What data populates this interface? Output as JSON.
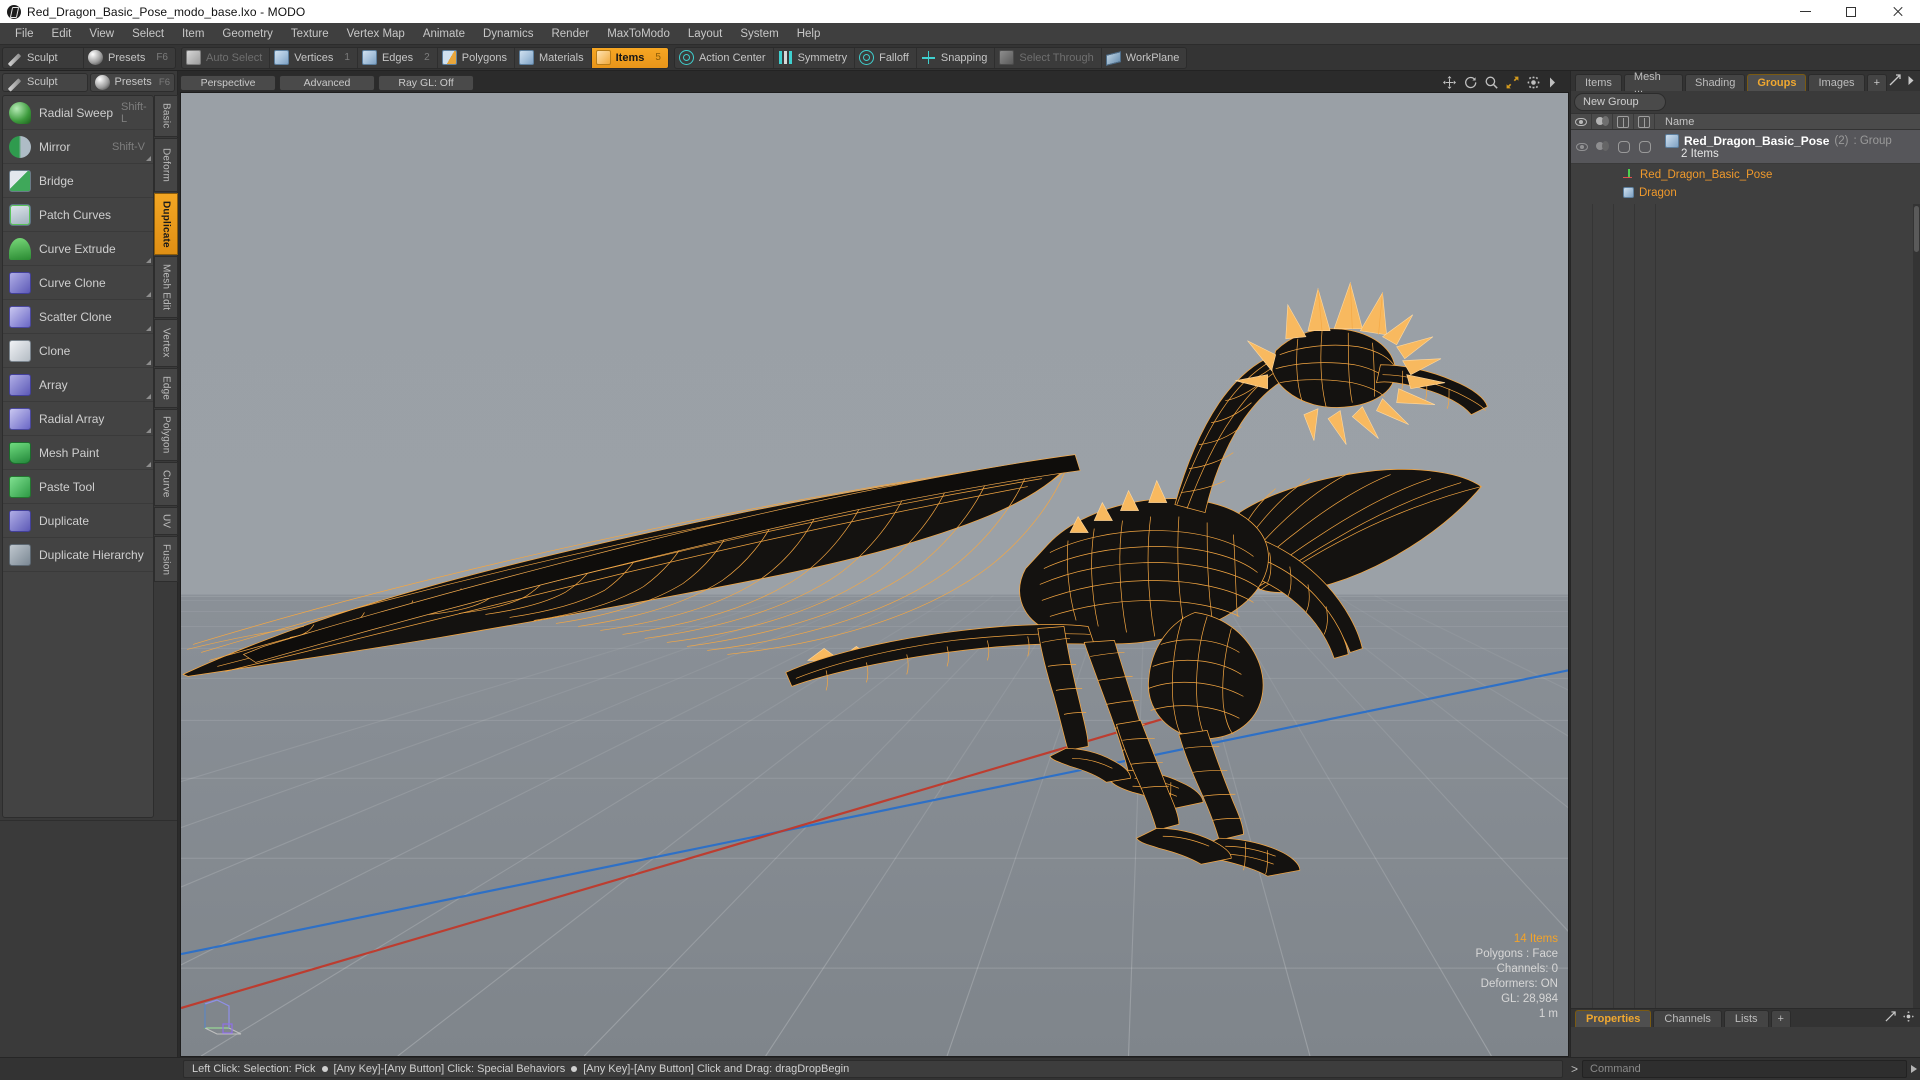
{
  "window": {
    "title": "Red_Dragon_Basic_Pose_modo_base.lxo - MODO",
    "minimize": "minimize",
    "maximize": "maximize",
    "close": "close"
  },
  "menubar": {
    "items": [
      {
        "label": "File"
      },
      {
        "label": "Edit"
      },
      {
        "label": "View"
      },
      {
        "label": "Select"
      },
      {
        "label": "Item"
      },
      {
        "label": "Geometry"
      },
      {
        "label": "Texture"
      },
      {
        "label": "Vertex Map"
      },
      {
        "label": "Animate"
      },
      {
        "label": "Dynamics"
      },
      {
        "label": "Render"
      },
      {
        "label": "MaxToModo"
      },
      {
        "label": "Layout"
      },
      {
        "label": "System"
      },
      {
        "label": "Help"
      }
    ]
  },
  "toolbar": {
    "left_group": [
      {
        "label": "Sculpt",
        "key": "",
        "icon": "pencil-icon",
        "state": "normal"
      },
      {
        "label": "Presets",
        "key": "F6",
        "icon": "sphere-icon",
        "state": "normal"
      }
    ],
    "selection_group": [
      {
        "label": "Auto Select",
        "num": "",
        "icon": "cube-grey-icon",
        "state": "dim"
      },
      {
        "label": "Vertices",
        "num": "1",
        "icon": "cube-icon",
        "state": "normal"
      },
      {
        "label": "Edges",
        "num": "2",
        "icon": "cube-icon",
        "state": "normal"
      },
      {
        "label": "Polygons",
        "num": "",
        "icon": "cube-half-icon",
        "state": "normal"
      },
      {
        "label": "Materials",
        "num": "",
        "icon": "cube-icon",
        "state": "normal"
      },
      {
        "label": "Items",
        "num": "5",
        "icon": "cube-orange-icon",
        "state": "active"
      }
    ],
    "modifier_group": [
      {
        "label": "Action Center",
        "icon": "crosshair-icon",
        "state": "normal"
      },
      {
        "label": "Symmetry",
        "icon": "bars-icon",
        "state": "normal"
      },
      {
        "label": "Falloff",
        "icon": "target-icon",
        "state": "normal"
      },
      {
        "label": "Snapping",
        "icon": "snap-icon",
        "state": "normal"
      },
      {
        "label": "Select Through",
        "icon": "select-through-icon",
        "state": "dim"
      },
      {
        "label": "WorkPlane",
        "icon": "workplane-icon",
        "state": "normal"
      }
    ]
  },
  "left_panel": {
    "header": [
      {
        "label": "Sculpt",
        "key": "",
        "icon": "pencil-icon"
      },
      {
        "label": "Presets",
        "key": "F6",
        "icon": "sphere-icon"
      }
    ],
    "tools": [
      {
        "label": "Radial Sweep",
        "key": "Shift-L",
        "icon": "radial-sweep-icon",
        "corner": false
      },
      {
        "label": "Mirror",
        "key": "Shift-V",
        "icon": "mirror-icon",
        "corner": true
      },
      {
        "label": "Bridge",
        "key": "",
        "icon": "bridge-icon",
        "corner": false
      },
      {
        "label": "Patch Curves",
        "key": "",
        "icon": "patch-curves-icon",
        "corner": false
      },
      {
        "label": "Curve Extrude",
        "key": "",
        "icon": "curve-extrude-icon",
        "corner": true
      },
      {
        "label": "Curve Clone",
        "key": "",
        "icon": "curve-clone-icon",
        "corner": true
      },
      {
        "label": "Scatter Clone",
        "key": "",
        "icon": "scatter-clone-icon",
        "corner": true
      },
      {
        "label": "Clone",
        "key": "",
        "icon": "clone-icon",
        "corner": true
      },
      {
        "label": "Array",
        "key": "",
        "icon": "array-icon",
        "corner": true
      },
      {
        "label": "Radial Array",
        "key": "",
        "icon": "radial-array-icon",
        "corner": true
      },
      {
        "label": "Mesh Paint",
        "key": "",
        "icon": "mesh-paint-icon",
        "corner": true
      },
      {
        "label": "Paste Tool",
        "key": "",
        "icon": "paste-tool-icon",
        "corner": false
      },
      {
        "label": "Duplicate",
        "key": "",
        "icon": "duplicate-icon",
        "corner": false
      },
      {
        "label": "Duplicate Hierarchy",
        "key": "",
        "icon": "duplicate-hierarchy-icon",
        "corner": false
      }
    ],
    "vtabs": [
      {
        "label": "Basic",
        "active": false
      },
      {
        "label": "Deform",
        "active": false
      },
      {
        "label": "Duplicate",
        "active": true
      },
      {
        "label": "Mesh Edit",
        "active": false
      },
      {
        "label": "Vertex",
        "active": false
      },
      {
        "label": "Edge",
        "active": false
      },
      {
        "label": "Polygon",
        "active": false
      },
      {
        "label": "Curve",
        "active": false
      },
      {
        "label": "UV",
        "active": false
      },
      {
        "label": "Fusion",
        "active": false
      }
    ]
  },
  "viewport": {
    "mode_pills": [
      {
        "label": "Perspective"
      },
      {
        "label": "Advanced"
      },
      {
        "label": "Ray GL: Off"
      }
    ],
    "corner_icons": [
      "move-icon",
      "rotate-icon",
      "zoom-icon",
      "fit-icon",
      "gear-icon",
      "chevron-right-icon"
    ],
    "info": {
      "items": "14 Items",
      "polygons": "Polygons : Face",
      "channels": "Channels: 0",
      "deformers": "Deformers: ON",
      "gl": "GL: 28,984",
      "scale": "1 m"
    },
    "model_name": "red-dragon-wireframe"
  },
  "right_panel": {
    "tabs": [
      {
        "label": "Items",
        "active": false
      },
      {
        "label": "Mesh ...",
        "active": false
      },
      {
        "label": "Shading",
        "active": false
      },
      {
        "label": "Groups",
        "active": true
      },
      {
        "label": "Images",
        "active": false
      },
      {
        "label": "+",
        "active": false
      }
    ],
    "new_group_button": "New Group",
    "list_header": {
      "col_visible": "eye-icon",
      "col_shading": "shading-icon",
      "col_render": "render-cube-icon",
      "col_lock": "lock-cube-icon",
      "name": "Name"
    },
    "group": {
      "name": "Red_Dragon_Basic_Pose",
      "count": "(2)",
      "type": ": Group",
      "subtitle": "2 Items",
      "children": [
        {
          "name": "Red_Dragon_Basic_Pose",
          "icon": "locator-icon"
        },
        {
          "name": "Dragon",
          "icon": "mesh-cube-icon"
        }
      ]
    },
    "bottom_tabs": [
      {
        "label": "Properties",
        "active": true
      },
      {
        "label": "Channels",
        "active": false
      },
      {
        "label": "Lists",
        "active": false
      },
      {
        "label": "+",
        "active": false
      }
    ]
  },
  "statusbar": {
    "message_parts": [
      "Left Click: Selection: Pick",
      "[Any Key]-[Any Button] Click: Special Behaviors",
      "[Any Key]-[Any Button] Click and Drag: dragDropBegin"
    ],
    "command_placeholder": "Command",
    "prompt": ">"
  },
  "colors": {
    "accent_orange": "#f0a830",
    "wireframe_orange": "#f5a742",
    "teal": "#3fd0cf",
    "axis_red": "#c0392b",
    "axis_blue": "#2a6fc9",
    "viewport_bg": "#9aa0a6"
  }
}
